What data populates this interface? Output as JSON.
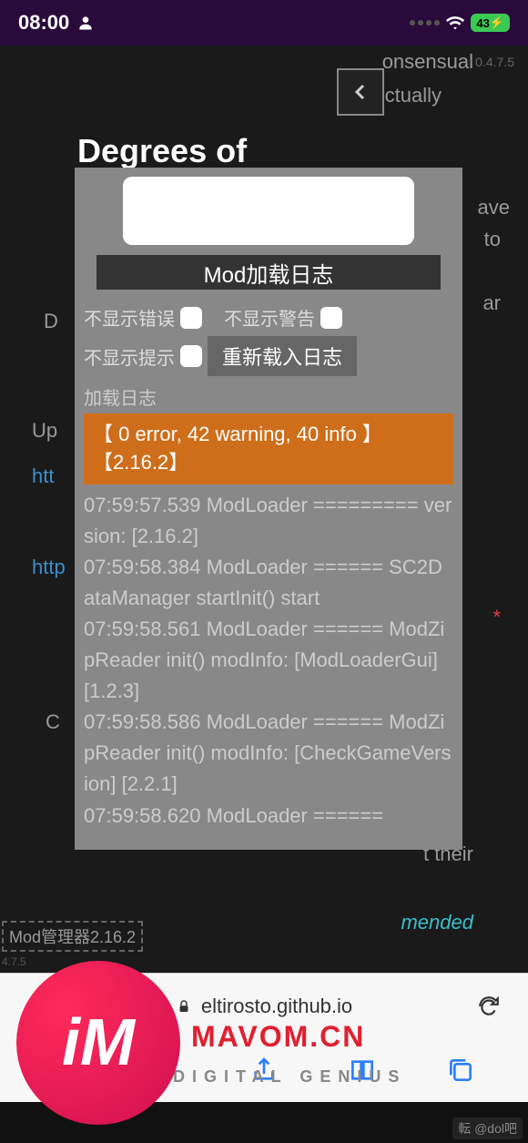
{
  "status": {
    "time": "08:00",
    "battery": "43"
  },
  "game": {
    "version": "0.4.7.5",
    "title": "Degrees of",
    "bg1": "onsensual",
    "bg2": "ctually",
    "bg3": "ave",
    "bg4": "to",
    "bg5": "ar",
    "bg6": "t their",
    "bg7": "mended",
    "link1": "htt",
    "link2": "http",
    "left_d": "D",
    "left_up": "Up",
    "left_c": "C",
    "asterisk": "*"
  },
  "modal": {
    "header": "Mod加载日志",
    "cb_error": "不显示错误",
    "cb_warn": "不显示警告",
    "cb_hint": "不显示提示",
    "reload": "重新载入日志",
    "log_label": "加载日志",
    "summary": "【 0 error, 42 warning, 40 info 】【2.16.2】",
    "lines": "07:59:57.539 ModLoader ========= version: [2.16.2]\n07:59:58.384 ModLoader ====== SC2DataManager startInit() start\n07:59:58.561 ModLoader ====== ModZipReader init() modInfo: [ModLoaderGui] [1.2.3]\n07:59:58.586 ModLoader ====== ModZipReader init() modInfo: [CheckGameVersion] [2.2.1]\n07:59:58.620 ModLoader ======"
  },
  "modmgr": {
    "label": "Mod管理器2.16.2",
    "ver": "4.7.5"
  },
  "browser": {
    "url": "eltirosto.github.io"
  },
  "brand": {
    "logo": "iM",
    "name": "MAVOM.CN",
    "sub": "DIGITAL GENIUS",
    "corner": "転 @dol吧"
  }
}
